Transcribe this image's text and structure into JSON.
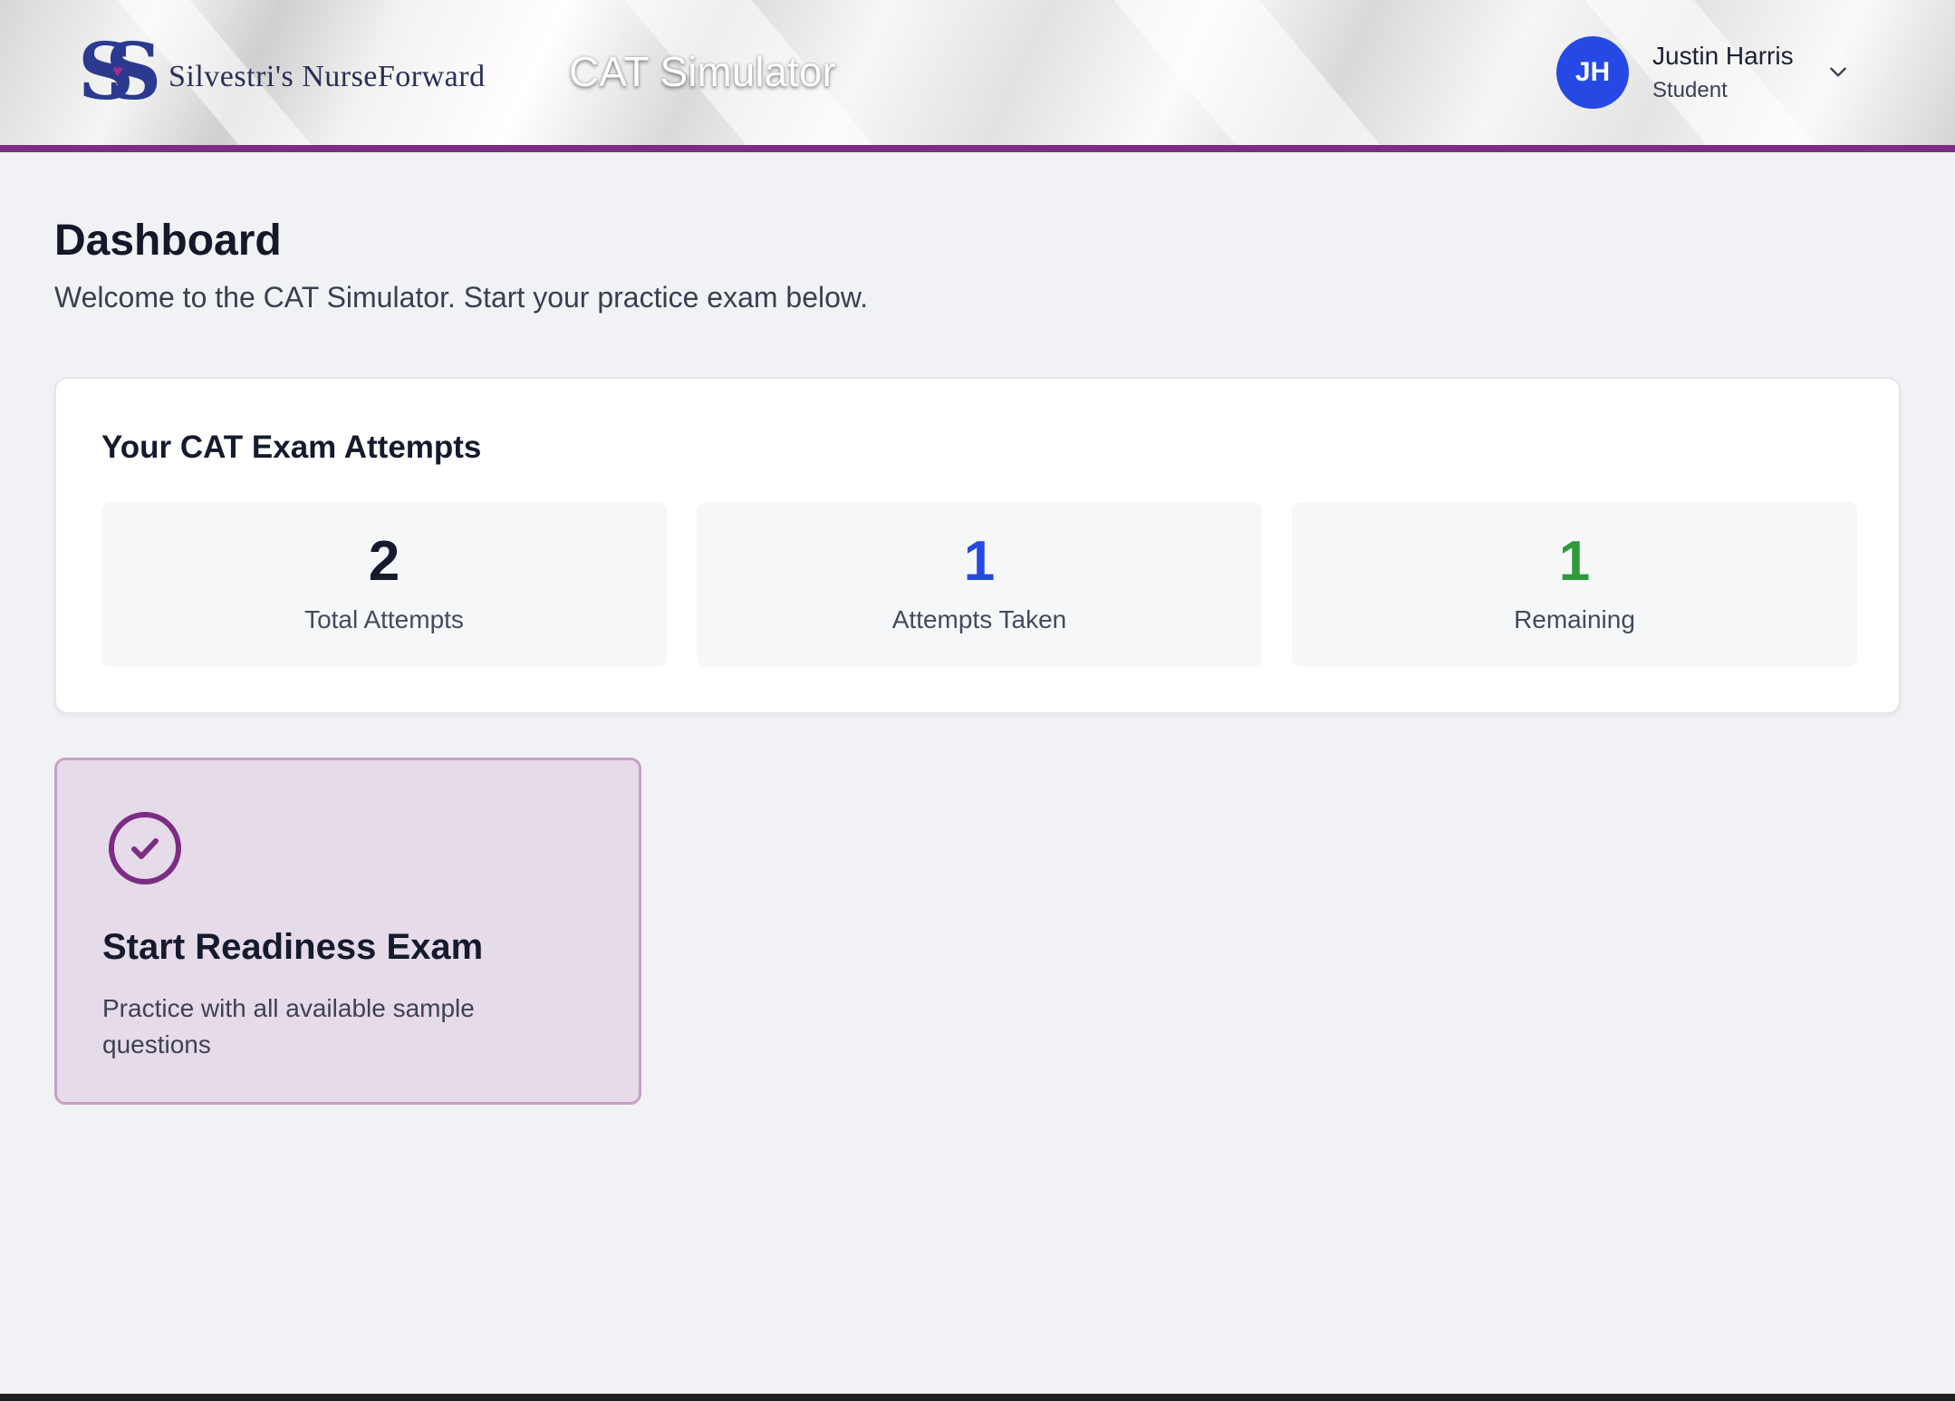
{
  "header": {
    "logo_text": "Silvestri's NurseForward",
    "app_title": "CAT Simulator",
    "user": {
      "initials": "JH",
      "name": "Justin Harris",
      "role": "Student"
    }
  },
  "main": {
    "title": "Dashboard",
    "subtitle": "Welcome to the CAT Simulator. Start your practice exam below.",
    "attempts": {
      "title": "Your CAT Exam Attempts",
      "stats": [
        {
          "value": "2",
          "label": "Total Attempts",
          "color": "#151a2d"
        },
        {
          "value": "1",
          "label": "Attempts Taken",
          "color": "#2549e0"
        },
        {
          "value": "1",
          "label": "Remaining",
          "color": "#2f9a3a"
        }
      ]
    },
    "exam_card": {
      "icon": "check-circle-icon",
      "title": "Start Readiness Exam",
      "description": "Practice with all available sample questions"
    }
  },
  "colors": {
    "accent": "#7b2d84",
    "avatar": "#2649e6"
  }
}
